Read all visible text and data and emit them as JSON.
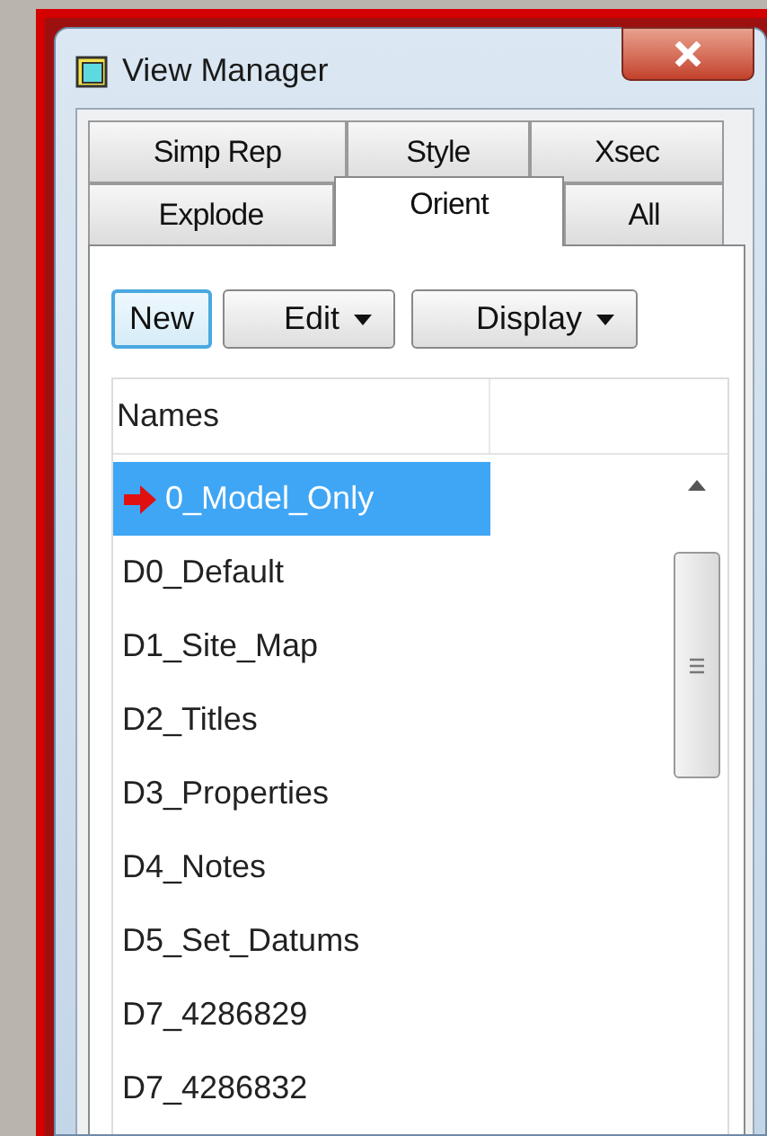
{
  "window": {
    "title": "View Manager"
  },
  "tab_rows": [
    [
      {
        "label": "Simp Rep",
        "selected": false
      },
      {
        "label": "Style",
        "selected": false
      },
      {
        "label": "Xsec",
        "selected": false
      }
    ],
    [
      {
        "label": "Explode",
        "selected": false
      },
      {
        "label": "Orient",
        "selected": true
      },
      {
        "label": "All",
        "selected": false
      }
    ]
  ],
  "buttons": [
    {
      "label": "New",
      "kind": "plain",
      "focused": true
    },
    {
      "label": "Edit",
      "kind": "dropdown",
      "focused": false
    },
    {
      "label": "Display",
      "kind": "dropdown",
      "focused": false
    }
  ],
  "list": {
    "columns": [
      "Names"
    ],
    "items": [
      {
        "name": "0_Model_Only",
        "selected": true,
        "current": true
      },
      {
        "name": "D0_Default",
        "selected": false,
        "current": false
      },
      {
        "name": "D1_Site_Map",
        "selected": false,
        "current": false
      },
      {
        "name": "D2_Titles",
        "selected": false,
        "current": false
      },
      {
        "name": "D3_Properties",
        "selected": false,
        "current": false
      },
      {
        "name": "D4_Notes",
        "selected": false,
        "current": false
      },
      {
        "name": "D5_Set_Datums",
        "selected": false,
        "current": false
      },
      {
        "name": "D7_4286829",
        "selected": false,
        "current": false
      },
      {
        "name": "D7_4286832",
        "selected": false,
        "current": false
      }
    ]
  }
}
